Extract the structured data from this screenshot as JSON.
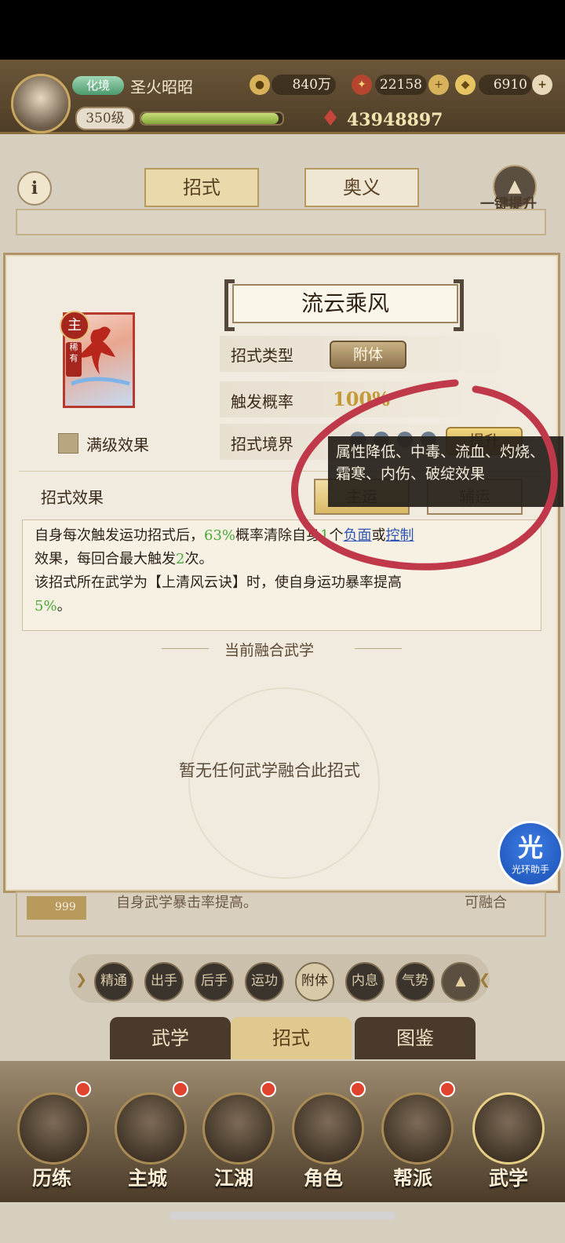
{
  "player": {
    "vip_badge": "化境",
    "name": "圣火昭昭",
    "level": "350级",
    "exp_fraction": 0.97,
    "silver": "840万",
    "stamina": "22158",
    "gold": "6910",
    "power": "43948897"
  },
  "top_tabs": {
    "moves": "招式",
    "mystery": "奥义",
    "one_key_upgrade": "一键提升"
  },
  "dialog": {
    "skill_name": "流云乘风",
    "badge_main": "主",
    "badge_rare": "稀有",
    "max_level_label": "满级效果",
    "type_label": "招式类型",
    "type_value": "附体",
    "trigger_label": "触发概率",
    "trigger_value": "100%",
    "realm_label": "招式境界",
    "upgrade_button": "提升",
    "effect_label": "招式效果",
    "main_move_button": "主运",
    "aux_move_button": "辅运",
    "effect_lines": {
      "l1a": "自身每次触发运功招式后，",
      "l1b": "63%",
      "l1c": "概率清除自身",
      "l1d": "1",
      "l1e": "个",
      "l1f": "负面",
      "l1g": "或",
      "l1h": "控制",
      "l2a": "效果，每回合最大触发",
      "l2b": "2",
      "l2c": "次。",
      "l3": "该招式所在武学为【上清风云诀】时，使自身运功暴率提高",
      "l4": "5%",
      "l4b": "。"
    },
    "fusion_title": "当前融合武学",
    "fusion_empty": "暂无任何武学融合此招式"
  },
  "tooltip": {
    "text": "属性降低、中毒、流血、灼烧、霜寒、内伤、破绽效果"
  },
  "helper": {
    "icon": "光",
    "label": "光环助手"
  },
  "background_list": {
    "row_text": "自身武学暴击率提高。",
    "row_status": "可融合",
    "row_badge": "999"
  },
  "categories": [
    "精通",
    "出手",
    "后手",
    "运功",
    "附体",
    "内息",
    "气势"
  ],
  "bottom_tabs": [
    "武学",
    "招式",
    "图鉴"
  ],
  "nav": [
    "历练",
    "主城",
    "江湖",
    "角色",
    "帮派",
    "武学"
  ],
  "colors": {
    "accent_gold": "#c49a38",
    "positive_green": "#4aa83a",
    "link_blue": "#2f55b4",
    "annotation_red": "#c0394a"
  }
}
